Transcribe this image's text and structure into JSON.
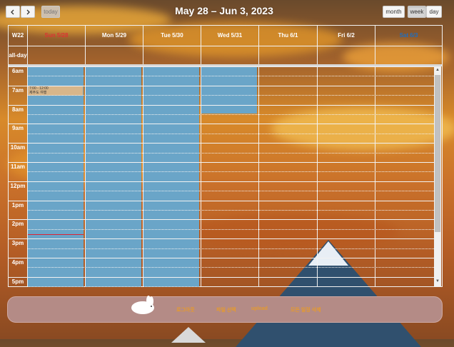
{
  "header": {
    "title": "May 28 – Jun 3, 2023",
    "prev_icon": "chevron-left-icon",
    "next_icon": "chevron-right-icon",
    "today_label": "today",
    "views": [
      "month",
      "week",
      "day"
    ],
    "active_view": "week"
  },
  "calendar": {
    "week_label": "W22",
    "allday_label": "all-day",
    "days": [
      {
        "label": "Sun 5/28",
        "color": "#d33"
      },
      {
        "label": "Mon 5/29",
        "color": "#ffffff"
      },
      {
        "label": "Tue 5/30",
        "color": "#ffffff"
      },
      {
        "label": "Wed 5/31",
        "color": "#ffffff"
      },
      {
        "label": "Thu 6/1",
        "color": "#ffffff"
      },
      {
        "label": "Fri 6/2",
        "color": "#ffffff"
      },
      {
        "label": "Sat 6/3",
        "color": "#1e6fc2"
      }
    ],
    "hours": [
      "6am",
      "7am",
      "8am",
      "9am",
      "10am",
      "11am",
      "12pm",
      "1pm",
      "2pm",
      "3pm",
      "4pm",
      "5pm"
    ],
    "event_time": "7:00 - 12:00",
    "event_title": "제주도 여행",
    "event_color": "#6aa5c8"
  },
  "footer": {
    "links": [
      "로그아웃",
      "파일 선택",
      "upload",
      "모든 일정 삭제"
    ]
  }
}
